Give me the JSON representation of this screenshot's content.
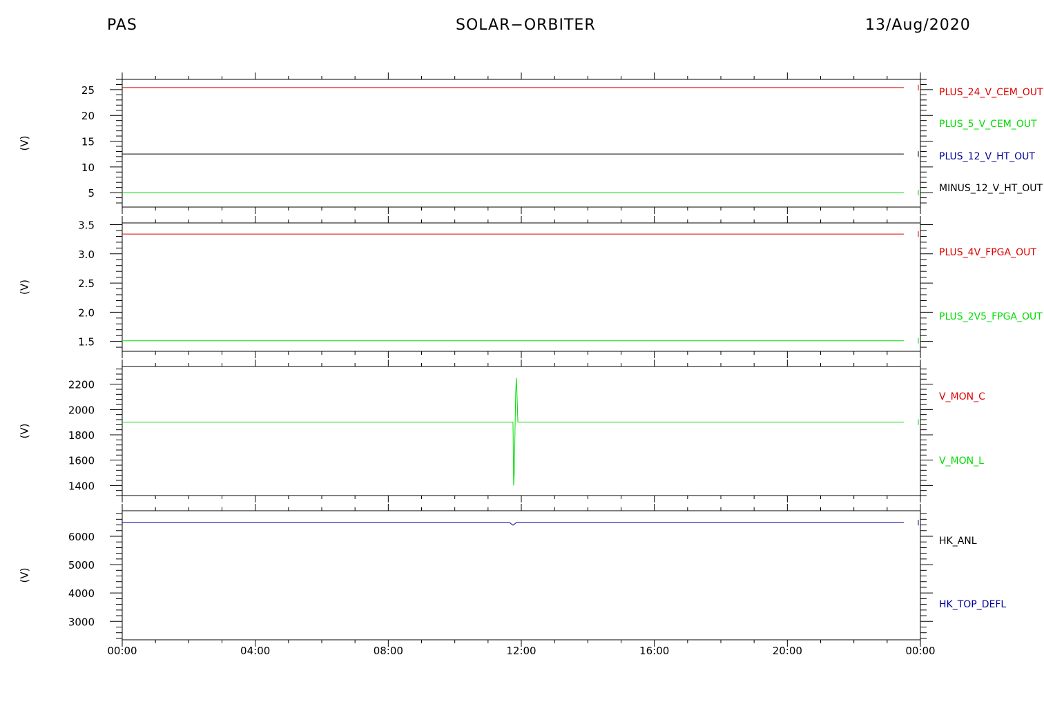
{
  "header": {
    "left": "PAS",
    "center": "SOLAR−ORBITER",
    "right": "13/Aug/2020"
  },
  "colors": {
    "red": "#dd0000",
    "green": "#00dd00",
    "blue": "#000099",
    "black": "#000000"
  },
  "chart_data": [
    {
      "type": "line",
      "ylabel": "(V)",
      "ylim": [
        2.2,
        27.0
      ],
      "yticks": [
        5,
        10,
        15,
        20,
        25
      ],
      "ytick_labels": [
        "5",
        "10",
        "15",
        "20",
        "25"
      ],
      "series": [
        {
          "name": "PLUS_24_V_CEM_OUT",
          "color": "#dd0000",
          "x": [
            0,
            24
          ],
          "y": [
            25.4,
            25.4
          ]
        },
        {
          "name": "PLUS_5_V_CEM_OUT",
          "color": "#00dd00",
          "x": [
            0,
            24
          ],
          "y": [
            5.0,
            5.0
          ]
        },
        {
          "name": "PLUS_12_V_HT_OUT",
          "color": "#000099",
          "x": [],
          "y": []
        },
        {
          "name": "MINUS_12_V_HT_OUT",
          "color": "#000000",
          "x": [
            0,
            24
          ],
          "y": [
            12.5,
            12.5
          ]
        }
      ]
    },
    {
      "type": "line",
      "ylabel": "(V)",
      "ylim": [
        1.33,
        3.53
      ],
      "yticks": [
        1.5,
        2.0,
        2.5,
        3.0,
        3.5
      ],
      "ytick_labels": [
        "1.5",
        "2.0",
        "2.5",
        "3.0",
        "3.5"
      ],
      "series": [
        {
          "name": "PLUS_4V_FPGA_OUT",
          "color": "#dd0000",
          "x": [
            0,
            24
          ],
          "y": [
            3.34,
            3.34
          ]
        },
        {
          "name": "PLUS_2V5_FPGA_OUT",
          "color": "#00dd00",
          "x": [
            0,
            24
          ],
          "y": [
            1.51,
            1.51
          ]
        }
      ]
    },
    {
      "type": "line",
      "ylabel": "(V)",
      "ylim": [
        1320,
        2340
      ],
      "yticks": [
        1400,
        1600,
        1800,
        2000,
        2200
      ],
      "ytick_labels": [
        "1400",
        "1600",
        "1800",
        "2000",
        "2200"
      ],
      "series": [
        {
          "name": "V_MON_C",
          "color": "#dd0000",
          "x": [],
          "y": []
        },
        {
          "name": "V_MON_L",
          "color": "#00dd00",
          "x": [
            0,
            12.0,
            12.02,
            12.04,
            12.06,
            12.08,
            12.1,
            12.12,
            12.15,
            12.18,
            24
          ],
          "y": [
            1900,
            1900,
            1400,
            1500,
            1800,
            2100,
            2250,
            2150,
            1900,
            1900,
            1900
          ]
        }
      ]
    },
    {
      "type": "line",
      "ylabel": "(V)",
      "ylim": [
        2350,
        6900
      ],
      "yticks": [
        3000,
        4000,
        5000,
        6000
      ],
      "ytick_labels": [
        "3000",
        "4000",
        "5000",
        "6000"
      ],
      "series": [
        {
          "name": "HK_ANL",
          "color": "#000000",
          "x": [],
          "y": []
        },
        {
          "name": "HK_TOP_DEFL",
          "color": "#000099",
          "x": [
            0,
            11.9,
            12.0,
            12.1,
            24
          ],
          "y": [
            6480,
            6480,
            6390,
            6480,
            6480
          ]
        }
      ]
    }
  ],
  "xaxis": {
    "xlim": [
      0,
      24
    ],
    "ticks": [
      0,
      4,
      8,
      12,
      16,
      20,
      24
    ],
    "labels": [
      "00:00",
      "04:00",
      "08:00",
      "12:00",
      "16:00",
      "20:00",
      "00:00"
    ]
  }
}
